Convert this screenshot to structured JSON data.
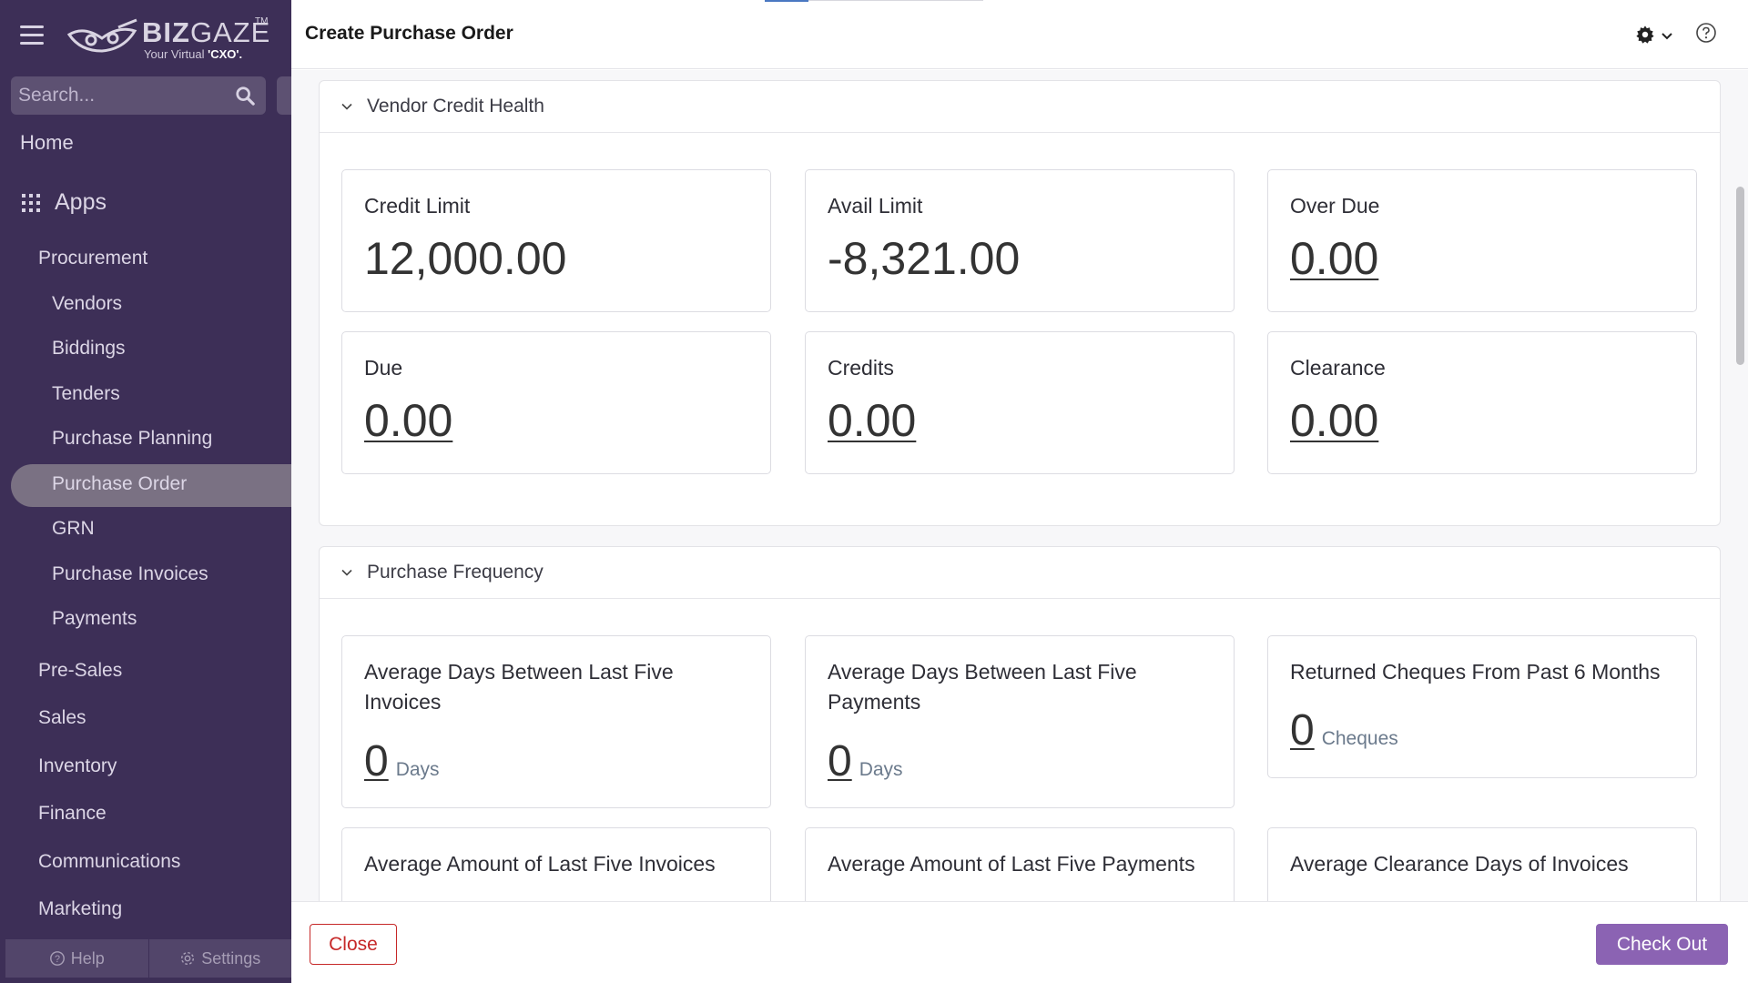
{
  "sidebar": {
    "logo": {
      "brand_bold": "BIZ",
      "brand_light": "GAZE",
      "trademark": "TM",
      "tagline_prefix": "Your Virtual ",
      "tagline_bold": "'CXO'."
    },
    "search_placeholder": "Search...",
    "home": "Home",
    "apps": "Apps",
    "procurement": "Procurement",
    "procurement_items": [
      "Vendors",
      "Biddings",
      "Tenders",
      "Purchase Planning",
      "Purchase Order",
      "GRN",
      "Purchase Invoices",
      "Payments"
    ],
    "active_item": "Purchase Order",
    "groups": [
      "Pre-Sales",
      "Sales",
      "Inventory",
      "Finance",
      "Communications",
      "Marketing"
    ],
    "footer": {
      "help": "Help",
      "settings": "Settings"
    }
  },
  "header": {
    "title": "Create Purchase Order"
  },
  "vendor_credit_health": {
    "title": "Vendor Credit Health",
    "cards": [
      {
        "label": "Credit Limit",
        "value": "12,000.00"
      },
      {
        "label": "Avail Limit",
        "value": "-8,321.00"
      },
      {
        "label": "Over Due",
        "value": "0.00"
      },
      {
        "label": "Due",
        "value": "0.00"
      },
      {
        "label": "Credits",
        "value": "0.00"
      },
      {
        "label": "Clearance",
        "value": "0.00"
      }
    ]
  },
  "purchase_frequency": {
    "title": "Purchase Frequency",
    "cards": [
      {
        "label": "Average Days Between Last Five Invoices",
        "value": "0",
        "unit": "Days"
      },
      {
        "label": "Average Days Between Last Five Payments",
        "value": "0",
        "unit": "Days"
      },
      {
        "label": "Returned Cheques From Past 6 Months",
        "value": "0",
        "unit": "Cheques"
      },
      {
        "label": "Average Amount of Last Five Invoices"
      },
      {
        "label": "Average Amount of Last Five Payments"
      },
      {
        "label": "Average Clearance Days of Invoices"
      }
    ]
  },
  "footer": {
    "close_label": "Close",
    "checkout_label": "Check Out"
  },
  "colors": {
    "sidebar_bg": "#3d2f57",
    "checkout_bg": "#8b63b3",
    "close_red": "#c62828"
  },
  "icons": [
    "hamburger-icon",
    "search-icon",
    "apps-grid-icon",
    "help-icon",
    "settings-icon",
    "gear-icon",
    "chevron-down-icon",
    "question-icon"
  ]
}
